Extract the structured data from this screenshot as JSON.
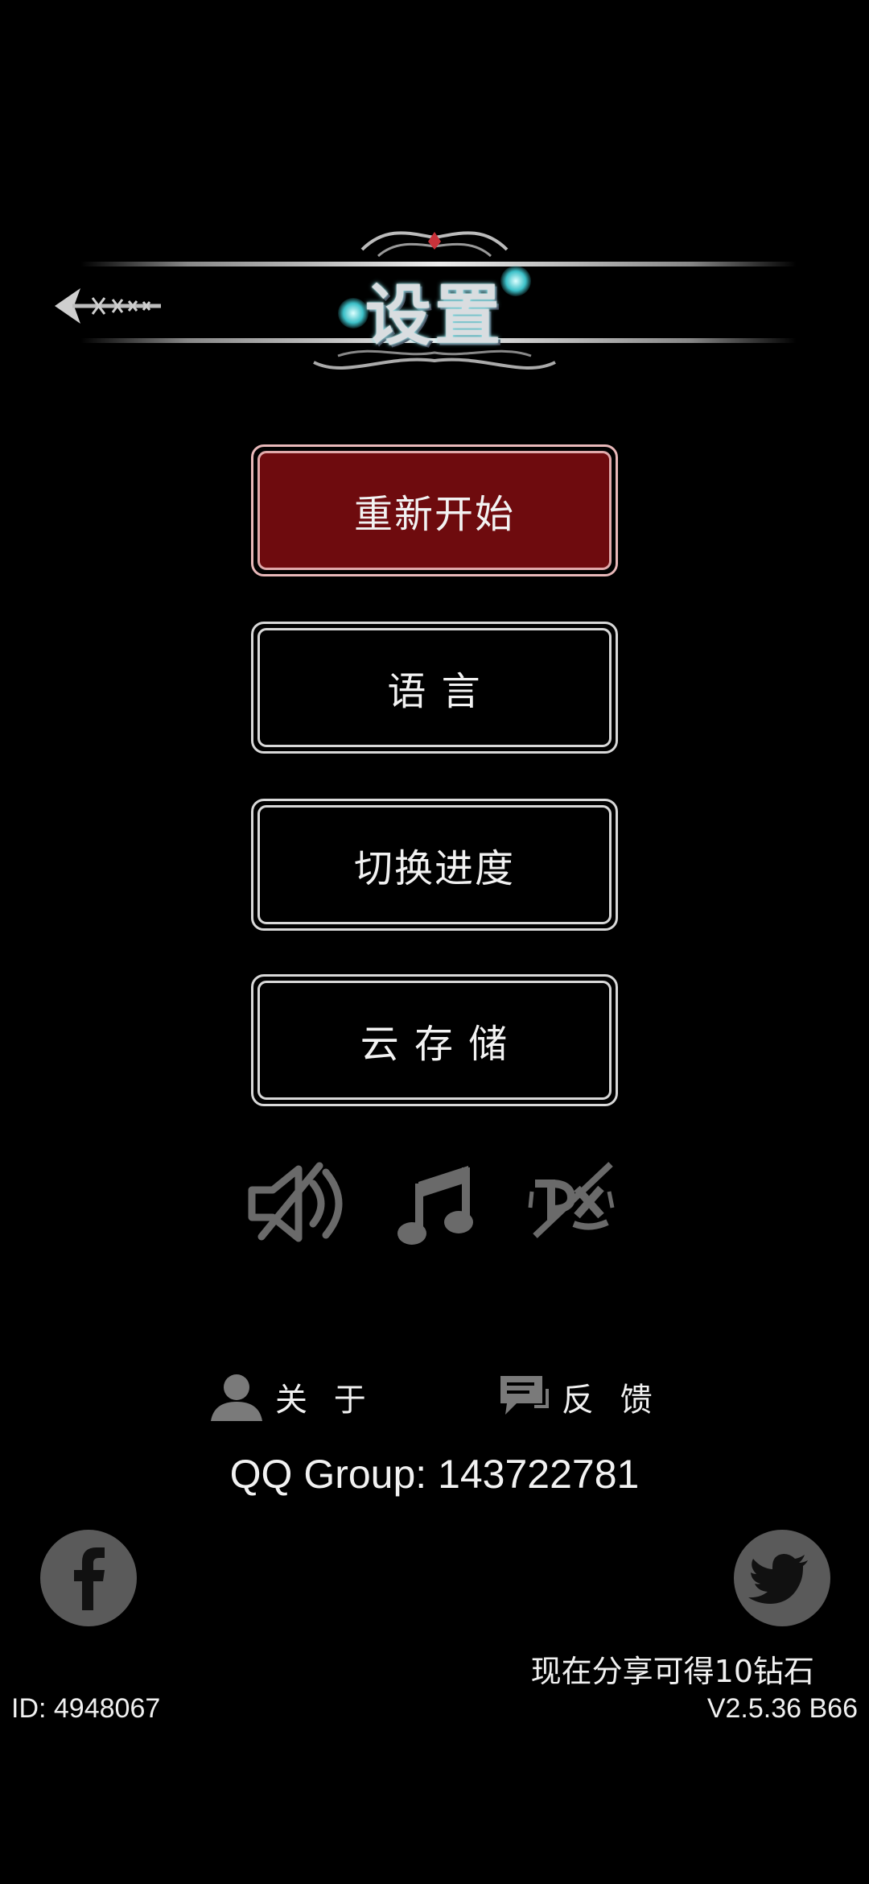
{
  "header": {
    "title": "设置",
    "back_icon": "ornate-back-arrow-icon",
    "back_button_label": "Back"
  },
  "menu": {
    "restart": "重新开始",
    "language": "语 言",
    "switch_progress": "切换进度",
    "cloud_storage": "云 存 储"
  },
  "toggles": {
    "sound": {
      "icon": "speaker-muted-icon",
      "state": "off"
    },
    "music": {
      "icon": "music-note-icon",
      "state": "on"
    },
    "vibration": {
      "icon": "vibrate-disabled-icon",
      "state": "off"
    }
  },
  "links": {
    "about": "关 于",
    "feedback": "反 馈"
  },
  "qq_group": "QQ Group: 143722781",
  "social": {
    "facebook_icon": "facebook-icon",
    "twitter_icon": "twitter-icon",
    "share_text": "现在分享可得10钻石"
  },
  "footer": {
    "id": "ID: 4948067",
    "version": "V2.5.36 B66"
  },
  "colors": {
    "background": "#000000",
    "primary_button": "#6e0b0e",
    "border": "#d8d8d8",
    "icon_gray": "#5a5a5a"
  }
}
